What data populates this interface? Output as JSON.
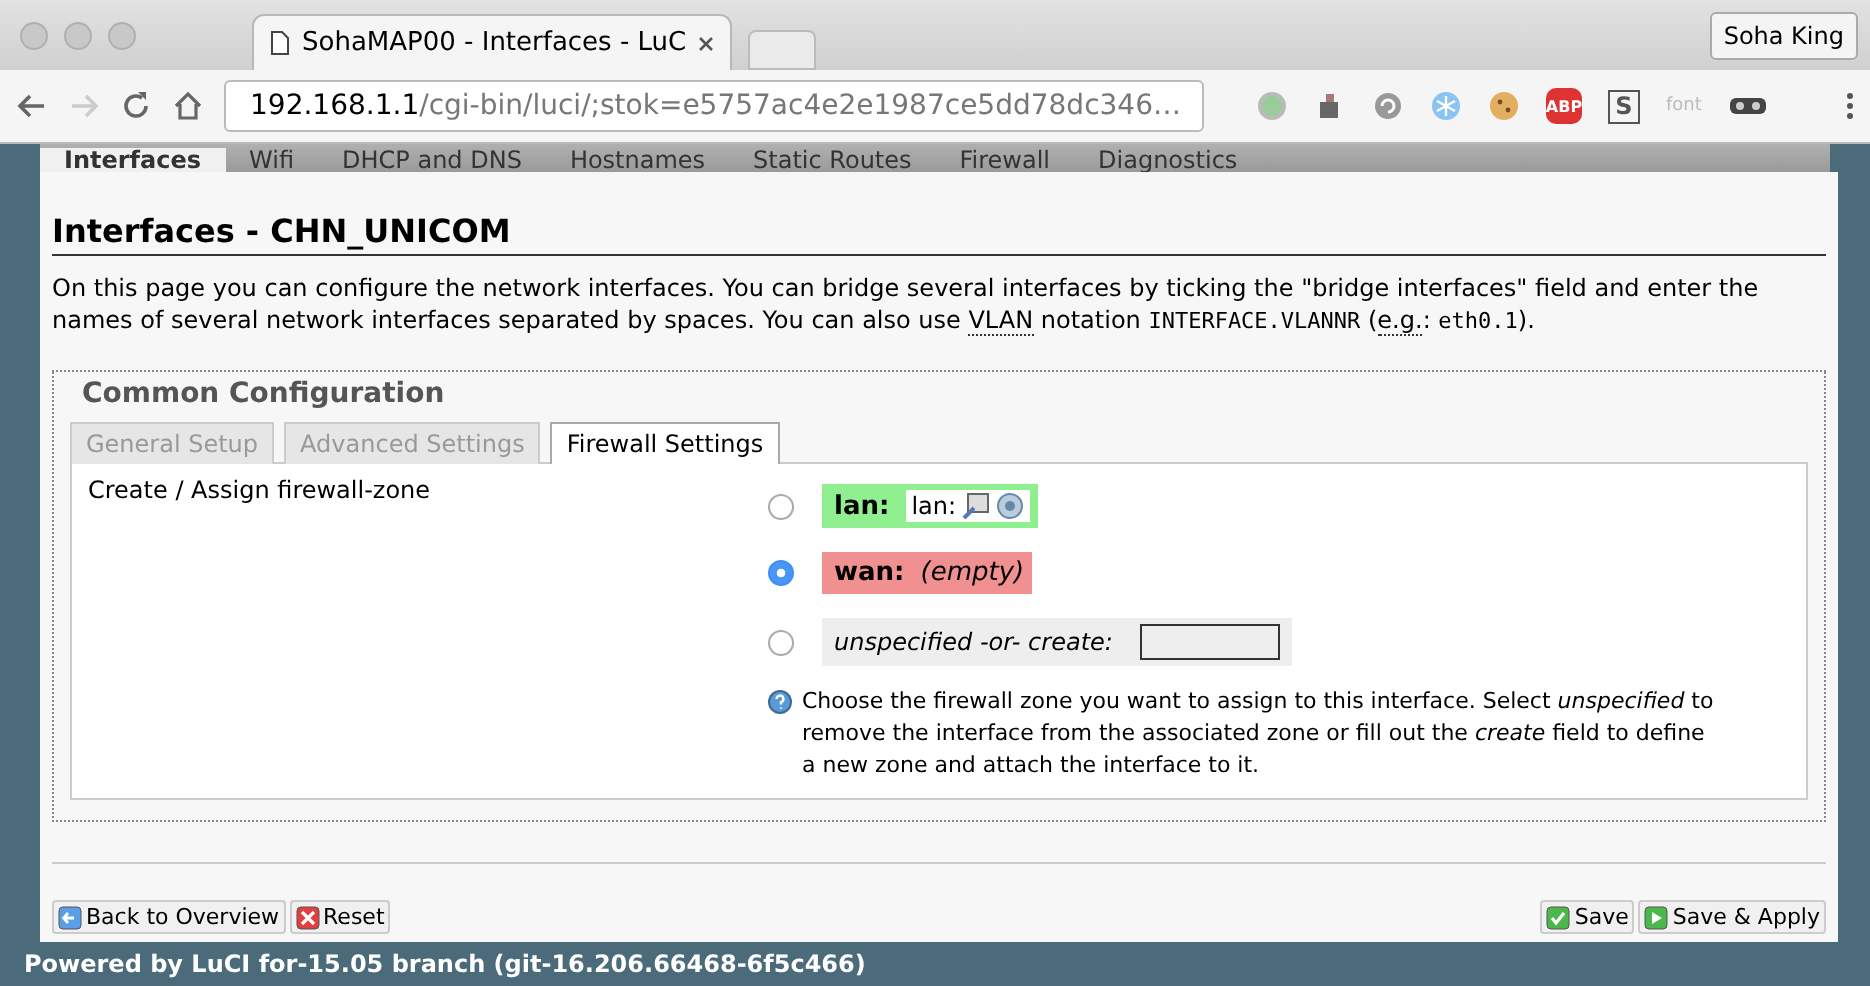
{
  "browser": {
    "tab_title": "SohaMAP00 - Interfaces - LuC",
    "profile": "Soha King",
    "url_host": "192.168.1.1",
    "url_rest": "/cgi-bin/luci/;stok=e5757ac4e2e1987ce5dd78dc346…",
    "extensions": [
      {
        "kind": "circle"
      },
      {
        "kind": "cup"
      },
      {
        "kind": "swirl"
      },
      {
        "kind": "flake"
      },
      {
        "kind": "cookie"
      },
      {
        "kind": "abp",
        "label": "ABP"
      },
      {
        "kind": "letter",
        "label": "S"
      },
      {
        "kind": "text",
        "label": "font"
      },
      {
        "kind": "mask"
      }
    ]
  },
  "nav_tabs": [
    {
      "label": "Interfaces",
      "selected": true
    },
    {
      "label": "Wifi",
      "selected": false
    },
    {
      "label": "DHCP and DNS",
      "selected": false
    },
    {
      "label": "Hostnames",
      "selected": false
    },
    {
      "label": "Static Routes",
      "selected": false
    },
    {
      "label": "Firewall",
      "selected": false
    },
    {
      "label": "Diagnostics",
      "selected": false
    }
  ],
  "heading": "Interfaces - CHN_UNICOM",
  "description": [
    {
      "kind": "text",
      "text": "On this page you can configure the network interfaces. You can bridge several interfaces by ticking the \"bridge interfaces\" field and enter the names of several network interfaces separated by spaces. You can also use "
    },
    {
      "kind": "abbr",
      "text": "VLAN"
    },
    {
      "kind": "text",
      "text": " notation "
    },
    {
      "kind": "code",
      "text": "INTERFACE.VLANNR"
    },
    {
      "kind": "text",
      "text": " ("
    },
    {
      "kind": "abbr",
      "text": "e.g."
    },
    {
      "kind": "text",
      "text": ": "
    },
    {
      "kind": "code",
      "text": "eth0.1"
    },
    {
      "kind": "text",
      "text": ")."
    }
  ],
  "section": {
    "legend": "Common Configuration",
    "tabs": [
      {
        "label": "General Setup",
        "selected": false
      },
      {
        "label": "Advanced Settings",
        "selected": false
      },
      {
        "label": "Firewall Settings",
        "selected": true
      }
    ],
    "field_label": "Create / Assign firewall-zone",
    "zones": [
      {
        "kind": "zone",
        "name": "lan:",
        "color": "#90f090",
        "selected": false,
        "network": "lan:"
      },
      {
        "kind": "zone",
        "name": "wan:",
        "color": "#f09090",
        "selected": true,
        "empty": "(empty)"
      },
      {
        "kind": "create",
        "label": "unspecified -or- create:",
        "selected": false
      }
    ],
    "help": "Choose the firewall zone you want to assign to this interface. Select *unspecified* to remove the interface from the associated zone or fill out the *create* field to define a new zone and attach the interface to it."
  },
  "buttons_left": [
    {
      "kind": "back",
      "label": "Back to Overview"
    },
    {
      "kind": "reset",
      "label": "Reset"
    }
  ],
  "buttons_right": [
    {
      "kind": "save",
      "label": "Save"
    },
    {
      "kind": "apply",
      "label": "Save & Apply"
    }
  ],
  "footer": "Powered by LuCI for-15.05 branch (git-16.206.66468-6f5c466)"
}
